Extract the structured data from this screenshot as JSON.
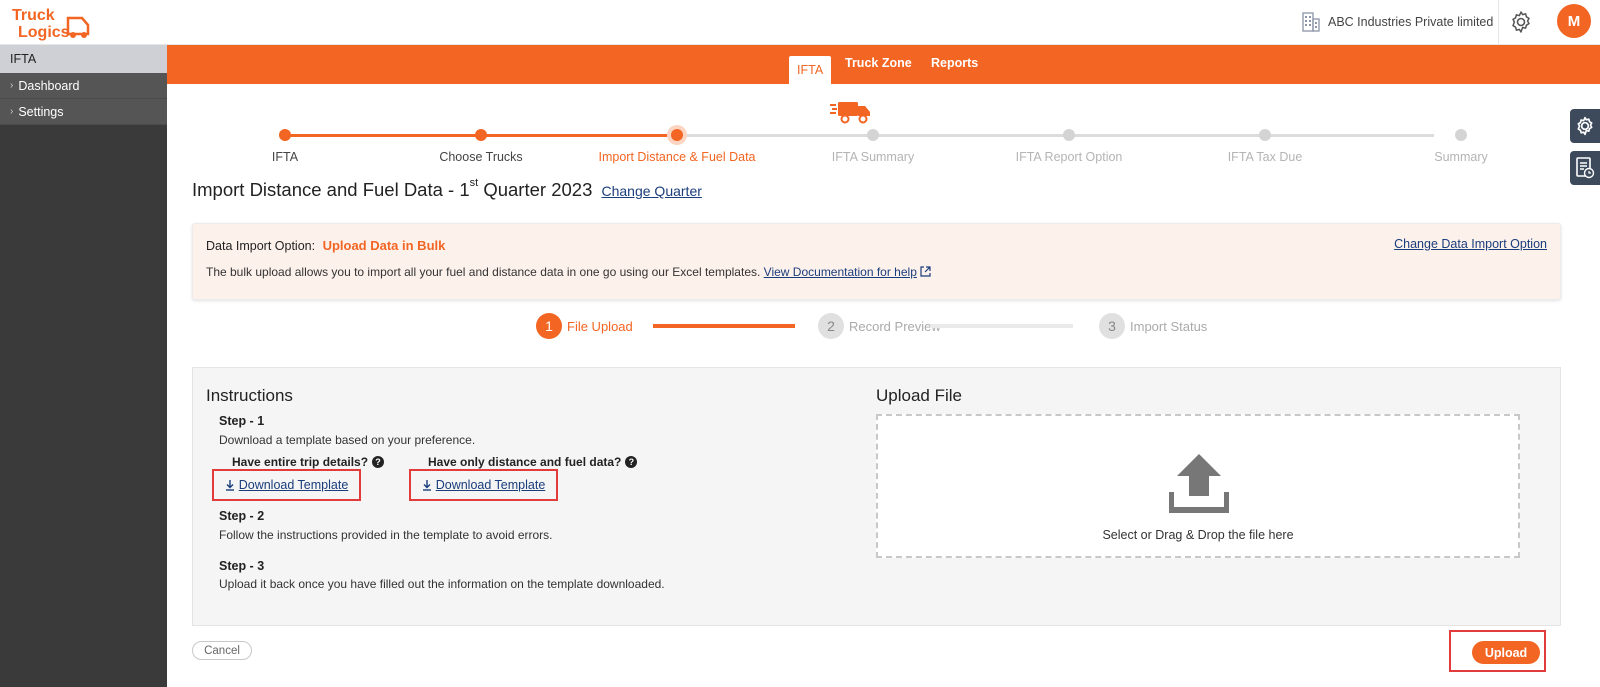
{
  "brand": {
    "logo_text": "Truck Logics",
    "accent": "#f26522"
  },
  "header": {
    "company": "ABC Industries Private limited",
    "avatar_initial": "M"
  },
  "sidebar": {
    "title": "IFTA",
    "items": [
      {
        "label": "Dashboard"
      },
      {
        "label": "Settings"
      }
    ]
  },
  "nav": {
    "tabs": [
      {
        "label": "IFTA",
        "active": true
      },
      {
        "label": "Truck Zone",
        "active": false
      },
      {
        "label": "Reports",
        "active": false
      }
    ]
  },
  "progress": {
    "steps": [
      {
        "label": "IFTA",
        "state": "done"
      },
      {
        "label": "Choose Trucks",
        "state": "done"
      },
      {
        "label": "Import Distance & Fuel Data",
        "state": "current"
      },
      {
        "label": "IFTA Summary",
        "state": "todo"
      },
      {
        "label": "IFTA Report Option",
        "state": "todo"
      },
      {
        "label": "IFTA Tax Due",
        "state": "todo"
      },
      {
        "label": "Summary",
        "state": "todo"
      }
    ]
  },
  "page": {
    "title_prefix": "Import Distance and Fuel Data - 1",
    "title_sup": "st",
    "title_suffix": " Quarter 2023",
    "change_quarter": "Change Quarter"
  },
  "import_option": {
    "label": "Data Import Option:",
    "value": "Upload Data in Bulk",
    "description": "The bulk upload allows you to import all your fuel and distance data in one go using our Excel templates.",
    "doc_link": "View Documentation for help",
    "change_link": "Change Data Import Option"
  },
  "sub_steps": [
    {
      "num": "1",
      "label": "File Upload",
      "active": true
    },
    {
      "num": "2",
      "label": "Record Preview",
      "active": false
    },
    {
      "num": "3",
      "label": "Import Status",
      "active": false
    }
  ],
  "instructions": {
    "title": "Instructions",
    "step1_heading": "Step - 1",
    "step1_text": "Download a template based on your preference.",
    "q1": "Have entire trip details?",
    "q2": "Have only distance and fuel data?",
    "download_label": "Download Template",
    "step2_heading": "Step - 2",
    "step2_text": "Follow the instructions provided in the template to avoid errors.",
    "step3_heading": "Step - 3",
    "step3_text": "Upload it back once you have filled out the information on the template downloaded."
  },
  "upload": {
    "title": "Upload File",
    "drop_text": "Select or Drag & Drop the file here"
  },
  "actions": {
    "cancel": "Cancel",
    "upload": "Upload"
  }
}
